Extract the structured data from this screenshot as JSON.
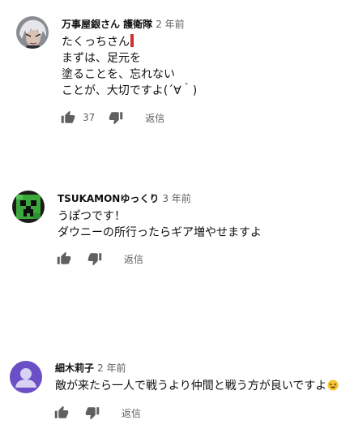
{
  "comments": [
    {
      "author": "万事屋銀さん 護衛隊",
      "time": "2 年前",
      "lines": [
        "たくっちさん",
        "まずは、足元を",
        "塗ることを、忘れない",
        "ことが、大切ですよ(´∀｀)"
      ],
      "likes": "37",
      "reply_label": "返信",
      "avatar_icon": "silver-hair-character-avatar"
    },
    {
      "author": "TSUKAMONゆっくり",
      "time": "3 年前",
      "lines": [
        "うぽつです！",
        "ダウニーの所行ったらギア増やせますよ"
      ],
      "likes": "",
      "reply_label": "返信",
      "avatar_icon": "creeper-face-avatar"
    },
    {
      "author": "細木莉子",
      "time": "2 年前",
      "lines": [
        "敵が来たら一人で戦うより仲間と戦う方が良いですよ"
      ],
      "likes": "",
      "reply_label": "返信",
      "avatar_icon": "default-person-avatar"
    }
  ],
  "colors": {
    "text": "#0f0f0f",
    "secondary": "#606060",
    "creeper_green": "#3aa83a",
    "default_avatar": "#6a4fc7",
    "accent_bar": "#d32f2f"
  }
}
